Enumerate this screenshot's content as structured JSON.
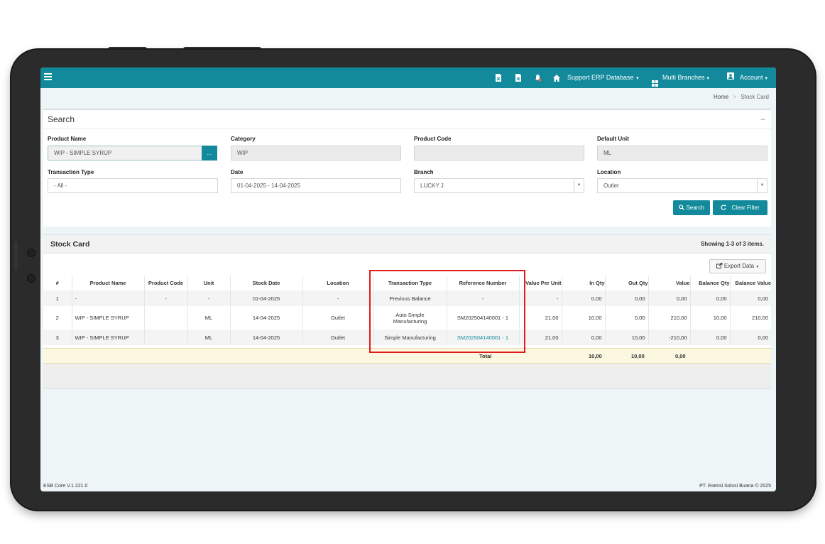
{
  "topbar": {
    "icons": [
      "report-icon",
      "report-icon",
      "bell-icon",
      "home-icon"
    ],
    "database_label": "Support ERP Database",
    "branches_label": "Multi Branches",
    "account_label": "Account"
  },
  "breadcrumb": {
    "home": "Home",
    "separator": ">",
    "current": "Stock Card"
  },
  "search": {
    "title": "Search",
    "collapse": "−",
    "product_name_label": "Product Name",
    "product_name_value": "WIP - SIMPLE SYRUP",
    "browse_label": "...",
    "category_label": "Category",
    "category_value": "WIP",
    "product_code_label": "Product Code",
    "product_code_value": "",
    "default_unit_label": "Default Unit",
    "default_unit_value": "ML",
    "transaction_type_label": "Transaction Type",
    "transaction_type_value": "- All -",
    "date_label": "Date",
    "date_value": "01-04-2025 - 14-04-2025",
    "branch_label": "Branch",
    "branch_value": "LUCKY J",
    "location_label": "Location",
    "location_value": "Outlet",
    "search_button": "Search",
    "clear_button": "Clear Filter"
  },
  "stock_card": {
    "title": "Stock Card",
    "summary": "Showing 1-3 of 3 items.",
    "export_button": "Export Data",
    "columns": [
      "#",
      "Product Name",
      "Product Code",
      "Unit",
      "Stock Date",
      "Location",
      "Transaction Type",
      "Reference Number",
      "Value Per Unit",
      "In Qty",
      "Out Qty",
      "Value",
      "Balance Qty",
      "Balance Value"
    ],
    "rows": [
      [
        "1",
        "-",
        "-",
        "-",
        "01-04-2025",
        "-",
        "Previous Balance",
        "-",
        "-",
        "0,00",
        "0,00",
        "0,00",
        "0,00",
        "0,00"
      ],
      [
        "2",
        "WIP - SIMPLE SYRUP",
        "",
        "ML",
        "14-04-2025",
        "Outlet",
        "Auto Simple Manufacturing",
        "SM202504140001 - 1",
        "21,00",
        "10,00",
        "0,00",
        "210,00",
        "10,00",
        "210,00"
      ],
      [
        "3",
        "WIP - SIMPLE SYRUP",
        "",
        "ML",
        "14-04-2025",
        "Outlet",
        "Simple Manufacturing",
        "SM202504140001 - 1",
        "21,00",
        "0,00",
        "10,00",
        "-210,00",
        "0,00",
        "0,00"
      ]
    ],
    "total_label": "Total",
    "total_in_qty": "10,00",
    "total_out_qty": "10,00",
    "total_value": "0,00"
  },
  "footer": {
    "version": "ESB Core V.1.221.0",
    "copyright": "PT. Esensi Solusi Buana © 2025"
  },
  "colors": {
    "brand": "#138a9c",
    "highlight": "#e01b1b",
    "total_bg": "#fcf7e1"
  }
}
